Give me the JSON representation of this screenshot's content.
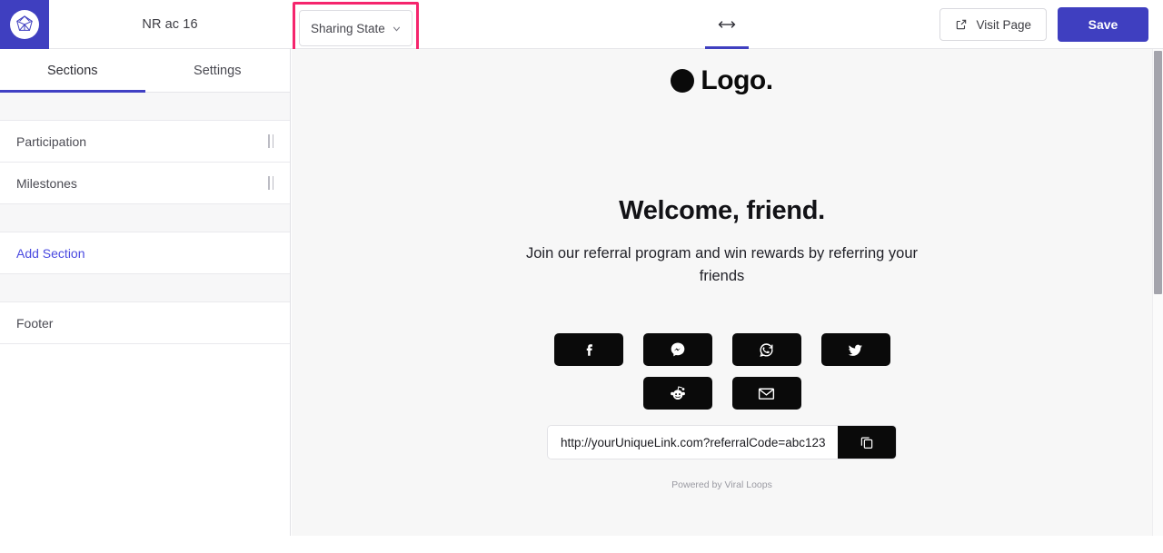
{
  "topbar": {
    "brand_icon": "viral-loops-gem-logo-icon",
    "project_title": "NR ac 16",
    "sharing_state": {
      "label": "Sharing State",
      "caret_icon": "chevron-down-icon",
      "annotation_color": "#f5256d"
    },
    "responsive_toggle": {
      "icon": "horizontal-resize-arrows-icon",
      "active": true,
      "active_color": "#3f3fc0"
    },
    "visit_page": {
      "label": "Visit Page",
      "icon": "external-link-icon"
    },
    "save": {
      "label": "Save",
      "color": "#3f3fc0"
    }
  },
  "sidebar": {
    "tabs": [
      {
        "label": "Sections",
        "active": true
      },
      {
        "label": "Settings",
        "active": false
      }
    ],
    "sections": [
      {
        "label": "Participation",
        "handle_icon": "drag-handle-icon"
      },
      {
        "label": "Milestones",
        "handle_icon": "drag-handle-icon"
      }
    ],
    "add_section": {
      "label": "Add Section",
      "color": "#4a4ae0"
    },
    "footer_item": {
      "label": "Footer"
    }
  },
  "canvas": {
    "logo": {
      "dot_icon": "black-circle-logo-mark-icon",
      "text": "Logo."
    },
    "hero": {
      "title": "Welcome, friend.",
      "subtitle": "Join our referral program and win rewards by referring your friends"
    },
    "share_buttons": [
      [
        {
          "name": "facebook",
          "icon": "facebook-icon"
        },
        {
          "name": "messenger",
          "icon": "messenger-icon"
        },
        {
          "name": "whatsapp",
          "icon": "whatsapp-icon"
        },
        {
          "name": "twitter",
          "icon": "twitter-icon"
        }
      ],
      [
        {
          "name": "reddit",
          "icon": "reddit-icon"
        },
        {
          "name": "email",
          "icon": "envelope-icon"
        }
      ]
    ],
    "referral_link": {
      "value": "http://yourUniqueLink.com?referralCode=abc123",
      "placeholder": "http://yourUniqueLink.com?referralCode=abc123",
      "copy_icon": "copy-icon"
    },
    "powered_by": "Powered by Viral Loops",
    "background": "#f7f7f7"
  },
  "scrollbar": {
    "thumb_color": "#a4a4ac"
  }
}
